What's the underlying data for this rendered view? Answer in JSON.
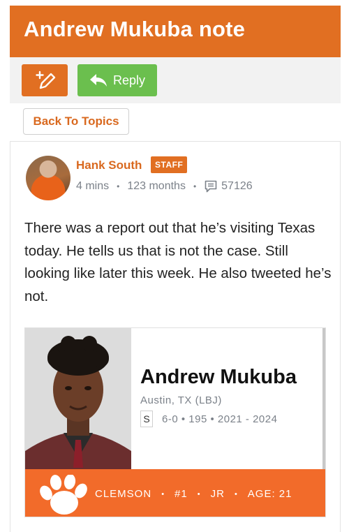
{
  "topic": {
    "title": "Andrew Mukuba note"
  },
  "toolbar": {
    "reply_label": "Reply"
  },
  "nav": {
    "back_label": "Back To Topics"
  },
  "post": {
    "author": "Hank South",
    "badge": "STAFF",
    "time_ago": "4 mins",
    "member_for": "123 months",
    "post_count": "57126",
    "body": "There was a report out that he’s visiting Texas today. He tells us that is not the case. Still looking like later this week. He also tweeted he’s not."
  },
  "player_card": {
    "name": "Andrew Mukuba",
    "hometown": "Austin, TX (LBJ)",
    "position": "S",
    "details": "6-0 • 195 • 2021 - 2024",
    "school": "CLEMSON",
    "number": "#1",
    "class_year": "JR",
    "age": "AGE: 21"
  },
  "colors": {
    "brand_orange": "#e16f22",
    "reply_green": "#6bbf4e",
    "footer_orange": "#f26b2a"
  }
}
